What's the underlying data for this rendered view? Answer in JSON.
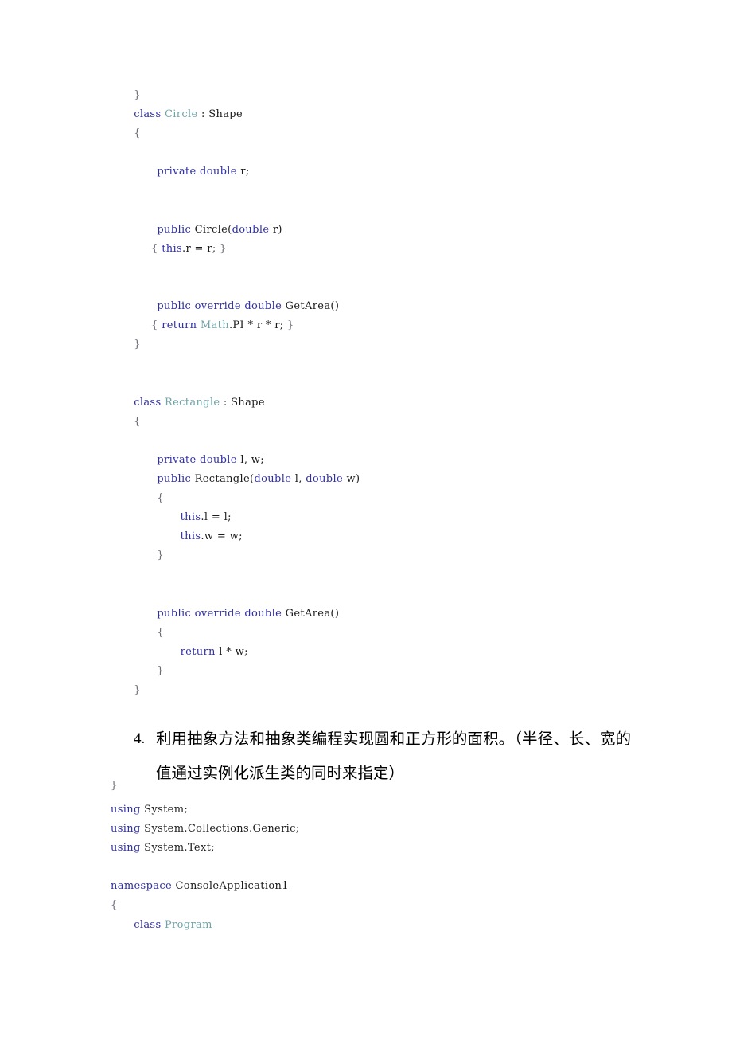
{
  "document": {
    "page_background": "#ffffff",
    "syntax_colors": {
      "keyword": "#2f2fa8",
      "type_name": "#6fa3a8",
      "plain": "#1b1b1b",
      "brace": "#6b6b78"
    }
  },
  "code_top": {
    "language": "csharp",
    "lines": [
      {
        "indent": 4,
        "tokens": [
          {
            "t": "}",
            "c": "brace"
          }
        ]
      },
      {
        "indent": 4,
        "tokens": [
          {
            "t": "class ",
            "c": "kw"
          },
          {
            "t": "Circle",
            "c": "type"
          },
          {
            "t": " : Shape",
            "c": "pln"
          }
        ]
      },
      {
        "indent": 4,
        "tokens": [
          {
            "t": "{",
            "c": "brace"
          }
        ]
      },
      {
        "indent": 4,
        "tokens": [
          {
            "t": "",
            "c": "pln"
          }
        ]
      },
      {
        "indent": 8,
        "tokens": [
          {
            "t": "private ",
            "c": "kw"
          },
          {
            "t": "double ",
            "c": "kw"
          },
          {
            "t": "r;",
            "c": "pln"
          }
        ]
      },
      {
        "indent": 8,
        "tokens": [
          {
            "t": "",
            "c": "pln"
          }
        ]
      },
      {
        "indent": 8,
        "tokens": [
          {
            "t": "",
            "c": "pln"
          }
        ]
      },
      {
        "indent": 8,
        "tokens": [
          {
            "t": "public ",
            "c": "kw"
          },
          {
            "t": "Circle(",
            "c": "pln"
          },
          {
            "t": "double ",
            "c": "kw"
          },
          {
            "t": "r)",
            "c": "pln"
          }
        ]
      },
      {
        "indent": 7,
        "tokens": [
          {
            "t": "{ ",
            "c": "brace"
          },
          {
            "t": "this",
            "c": "kw"
          },
          {
            "t": ".r = r; ",
            "c": "pln"
          },
          {
            "t": "}",
            "c": "brace"
          }
        ]
      },
      {
        "indent": 8,
        "tokens": [
          {
            "t": "",
            "c": "pln"
          }
        ]
      },
      {
        "indent": 8,
        "tokens": [
          {
            "t": "",
            "c": "pln"
          }
        ]
      },
      {
        "indent": 8,
        "tokens": [
          {
            "t": "public ",
            "c": "kw"
          },
          {
            "t": "override ",
            "c": "kw"
          },
          {
            "t": "double ",
            "c": "kw"
          },
          {
            "t": "GetArea()",
            "c": "pln"
          }
        ]
      },
      {
        "indent": 7,
        "tokens": [
          {
            "t": "{ ",
            "c": "brace"
          },
          {
            "t": "return ",
            "c": "kw"
          },
          {
            "t": "Math",
            "c": "type"
          },
          {
            "t": ".PI * r * r; ",
            "c": "pln"
          },
          {
            "t": "}",
            "c": "brace"
          }
        ]
      },
      {
        "indent": 4,
        "tokens": [
          {
            "t": "}",
            "c": "brace"
          }
        ]
      },
      {
        "indent": 4,
        "tokens": [
          {
            "t": "",
            "c": "pln"
          }
        ]
      },
      {
        "indent": 4,
        "tokens": [
          {
            "t": "",
            "c": "pln"
          }
        ]
      },
      {
        "indent": 4,
        "tokens": [
          {
            "t": "class ",
            "c": "kw"
          },
          {
            "t": "Rectangle",
            "c": "type"
          },
          {
            "t": " : Shape",
            "c": "pln"
          }
        ]
      },
      {
        "indent": 4,
        "tokens": [
          {
            "t": "{",
            "c": "brace"
          }
        ]
      },
      {
        "indent": 4,
        "tokens": [
          {
            "t": "",
            "c": "pln"
          }
        ]
      },
      {
        "indent": 8,
        "tokens": [
          {
            "t": "private ",
            "c": "kw"
          },
          {
            "t": "double ",
            "c": "kw"
          },
          {
            "t": "l, w;",
            "c": "pln"
          }
        ]
      },
      {
        "indent": 8,
        "tokens": [
          {
            "t": "public ",
            "c": "kw"
          },
          {
            "t": "Rectangle(",
            "c": "pln"
          },
          {
            "t": "double ",
            "c": "kw"
          },
          {
            "t": "l, ",
            "c": "pln"
          },
          {
            "t": "double ",
            "c": "kw"
          },
          {
            "t": "w)",
            "c": "pln"
          }
        ]
      },
      {
        "indent": 8,
        "tokens": [
          {
            "t": "{",
            "c": "brace"
          }
        ]
      },
      {
        "indent": 12,
        "tokens": [
          {
            "t": "this",
            "c": "kw"
          },
          {
            "t": ".l = l;",
            "c": "pln"
          }
        ]
      },
      {
        "indent": 12,
        "tokens": [
          {
            "t": "this",
            "c": "kw"
          },
          {
            "t": ".w = w;",
            "c": "pln"
          }
        ]
      },
      {
        "indent": 8,
        "tokens": [
          {
            "t": "}",
            "c": "brace"
          }
        ]
      },
      {
        "indent": 8,
        "tokens": [
          {
            "t": "",
            "c": "pln"
          }
        ]
      },
      {
        "indent": 8,
        "tokens": [
          {
            "t": "",
            "c": "pln"
          }
        ]
      },
      {
        "indent": 8,
        "tokens": [
          {
            "t": "public ",
            "c": "kw"
          },
          {
            "t": "override ",
            "c": "kw"
          },
          {
            "t": "double ",
            "c": "kw"
          },
          {
            "t": "GetArea()",
            "c": "pln"
          }
        ]
      },
      {
        "indent": 8,
        "tokens": [
          {
            "t": "{",
            "c": "brace"
          }
        ]
      },
      {
        "indent": 12,
        "tokens": [
          {
            "t": "return ",
            "c": "kw"
          },
          {
            "t": "l * w;",
            "c": "pln"
          }
        ]
      },
      {
        "indent": 8,
        "tokens": [
          {
            "t": "}",
            "c": "brace"
          }
        ]
      },
      {
        "indent": 4,
        "tokens": [
          {
            "t": "}",
            "c": "brace"
          }
        ]
      },
      {
        "indent": 4,
        "tokens": [
          {
            "t": "",
            "c": "pln"
          }
        ]
      },
      {
        "indent": 4,
        "tokens": [
          {
            "t": "",
            "c": "pln"
          }
        ]
      },
      {
        "indent": 4,
        "tokens": [
          {
            "t": "",
            "c": "pln"
          }
        ]
      },
      {
        "indent": 4,
        "tokens": [
          {
            "t": "",
            "c": "pln"
          }
        ]
      },
      {
        "indent": 0,
        "tokens": [
          {
            "t": "}",
            "c": "brace"
          }
        ]
      }
    ]
  },
  "heading": {
    "marker": "4.",
    "text": "利用抽象方法和抽象类编程实现圆和正方形的面积。（半径、长、宽的值通过实例化派生类的同时来指定）"
  },
  "code_bottom": {
    "language": "csharp",
    "lines": [
      {
        "indent": 0,
        "tokens": [
          {
            "t": "using ",
            "c": "kw"
          },
          {
            "t": "System;",
            "c": "pln"
          }
        ]
      },
      {
        "indent": 0,
        "tokens": [
          {
            "t": "using ",
            "c": "kw"
          },
          {
            "t": "System.Collections.Generic;",
            "c": "pln"
          }
        ]
      },
      {
        "indent": 0,
        "tokens": [
          {
            "t": "using ",
            "c": "kw"
          },
          {
            "t": "System.Text;",
            "c": "pln"
          }
        ]
      },
      {
        "indent": 0,
        "tokens": [
          {
            "t": "",
            "c": "pln"
          }
        ]
      },
      {
        "indent": 0,
        "tokens": [
          {
            "t": "namespace ",
            "c": "kw"
          },
          {
            "t": "ConsoleApplication1",
            "c": "pln"
          }
        ]
      },
      {
        "indent": 0,
        "tokens": [
          {
            "t": "{",
            "c": "brace"
          }
        ]
      },
      {
        "indent": 4,
        "tokens": [
          {
            "t": "class ",
            "c": "kw"
          },
          {
            "t": "Program",
            "c": "type"
          }
        ]
      }
    ]
  }
}
